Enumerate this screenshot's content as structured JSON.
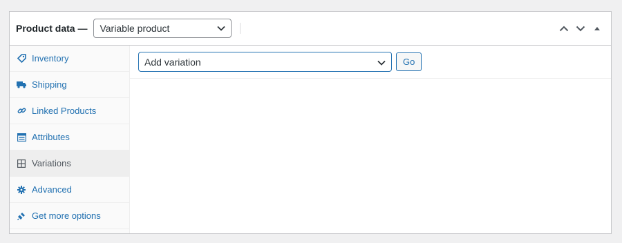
{
  "header": {
    "title": "Product data —",
    "product_type_value": "Variable product"
  },
  "tabs": [
    {
      "label": "Inventory",
      "icon": "tag-icon"
    },
    {
      "label": "Shipping",
      "icon": "truck-icon"
    },
    {
      "label": "Linked Products",
      "icon": "link-icon"
    },
    {
      "label": "Attributes",
      "icon": "list-icon"
    },
    {
      "label": "Variations",
      "icon": "grid-icon",
      "active": true
    },
    {
      "label": "Advanced",
      "icon": "gear-icon"
    },
    {
      "label": "Get more options",
      "icon": "plugin-icon"
    }
  ],
  "variations": {
    "action_value": "Add variation",
    "go_label": "Go"
  },
  "colors": {
    "link": "#2271b1",
    "border": "#c3c4c7",
    "background": "#f0f0f1"
  }
}
